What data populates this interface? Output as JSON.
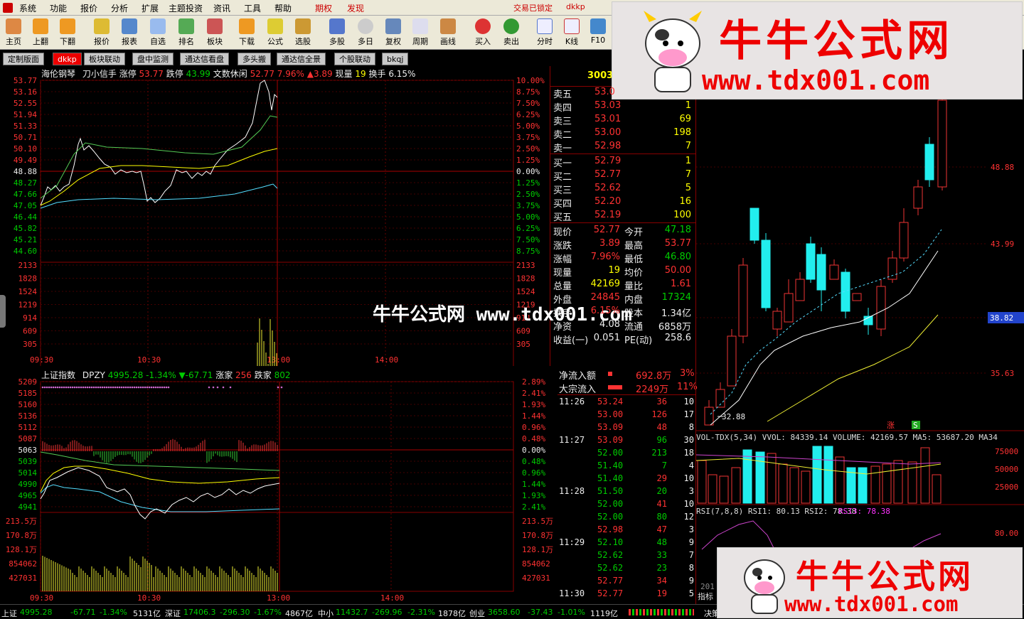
{
  "menu": {
    "items": [
      "系统",
      "功能",
      "报价",
      "分析",
      "扩展",
      "主题投资",
      "资讯",
      "工具",
      "帮助"
    ],
    "tabs_red": [
      "期权",
      "发现"
    ],
    "trade_status": "交易已锁定",
    "user": "dkkp"
  },
  "toolbar": [
    "主页",
    "上翻",
    "下翻",
    "报价",
    "报表",
    "自选",
    "排名",
    "板块",
    "下载",
    "公式",
    "选股",
    "多股",
    "多日",
    "复权",
    "周期",
    "画线",
    "买入",
    "卖出",
    "分时",
    "K线",
    "F10"
  ],
  "tabs": [
    "定制版面",
    "dkkp",
    "板块联动",
    "盘中监测",
    "通达信看盘",
    "多头搬",
    "通达信全景",
    "个股联动",
    "bkqj"
  ],
  "stock": {
    "name": "海伦钢琴",
    "indicator": "刀小信手",
    "limit_up_label": "涨停",
    "limit_up": "53.77",
    "limit_down_label": "跌停",
    "limit_down": "43.99",
    "note": "文数休闲",
    "price": "52.77",
    "pct": "7.96%",
    "change": "▲3.89",
    "vol_label": "现量",
    "vol": "19",
    "turnover_label": "换手",
    "turnover": "6.15%",
    "code": "30032"
  },
  "price_axis": [
    "53.77",
    "53.16",
    "52.55",
    "51.94",
    "51.33",
    "50.71",
    "50.10",
    "49.49",
    "48.88",
    "48.27",
    "47.66",
    "47.05",
    "46.44",
    "45.82",
    "45.21",
    "44.60"
  ],
  "pct_axis": [
    "10.00%",
    "8.75%",
    "7.50%",
    "6.25%",
    "5.00%",
    "3.75%",
    "2.50%",
    "1.25%",
    "0.00%",
    "1.25%",
    "2.50%",
    "3.75%",
    "5.00%",
    "6.25%",
    "7.50%",
    "8.75%"
  ],
  "vol_axis": [
    "2133",
    "1828",
    "1524",
    "1219",
    "914",
    "609",
    "305"
  ],
  "time_axis": [
    "09:30",
    "10:30",
    "13:00",
    "14:00"
  ],
  "index": {
    "name": "上证指数",
    "code": "DPZY",
    "value": "4995.28",
    "pct": "-1.34%",
    "change": "▼-67.71",
    "up_label": "涨家",
    "up": "256",
    "down_label": "跌家",
    "down": "802"
  },
  "index_axis": [
    "5209",
    "5185",
    "5160",
    "5136",
    "5112",
    "5087",
    "5063",
    "5039",
    "5014",
    "4990",
    "4965",
    "4941"
  ],
  "index_pct_axis": [
    "2.89%",
    "2.41%",
    "1.93%",
    "1.44%",
    "0.96%",
    "0.48%",
    "0.00%",
    "0.48%",
    "0.96%",
    "1.44%",
    "1.93%",
    "2.41%"
  ],
  "index_vol_axis": [
    "213.5万",
    "170.8万",
    "128.1万",
    "854062",
    "427031"
  ],
  "asks": [
    {
      "label": "卖五",
      "price": "53.0",
      "vol": ""
    },
    {
      "label": "卖四",
      "price": "53.03",
      "vol": "1"
    },
    {
      "label": "卖三",
      "price": "53.01",
      "vol": "69"
    },
    {
      "label": "卖二",
      "price": "53.00",
      "vol": "198"
    },
    {
      "label": "卖一",
      "price": "52.98",
      "vol": "7"
    }
  ],
  "bids": [
    {
      "label": "买一",
      "price": "52.79",
      "vol": "1"
    },
    {
      "label": "买二",
      "price": "52.77",
      "vol": "7"
    },
    {
      "label": "买三",
      "price": "52.62",
      "vol": "5"
    },
    {
      "label": "买四",
      "price": "52.20",
      "vol": "16"
    },
    {
      "label": "买五",
      "price": "52.19",
      "vol": "100"
    }
  ],
  "stats": [
    {
      "l1": "现价",
      "v1": "52.77",
      "l2": "今开",
      "v2": "47.18"
    },
    {
      "l1": "涨跌",
      "v1": "3.89",
      "l2": "最高",
      "v2": "53.77"
    },
    {
      "l1": "涨幅",
      "v1": "7.96%",
      "l2": "最低",
      "v2": "46.80"
    },
    {
      "l1": "现量",
      "v1": "19",
      "l2": "均价",
      "v2": "50.00"
    },
    {
      "l1": "总量",
      "v1": "42169",
      "l2": "量比",
      "v2": "1.61"
    },
    {
      "l1": "外盘",
      "v1": "24845",
      "l2": "内盘",
      "v2": "17324"
    },
    {
      "l1": "换手",
      "v1": "6.15%",
      "l2": "股本",
      "v2": "1.34亿"
    },
    {
      "l1": "净资",
      "v1": "4.08",
      "l2": "流通",
      "v2": "6858万"
    },
    {
      "l1": "收益(一)",
      "v1": "0.051",
      "l2": "PE(动)",
      "v2": "258.6"
    }
  ],
  "flow": [
    {
      "label": "净流入额",
      "value": "692.8万",
      "pct": "3%"
    },
    {
      "label": "大宗流入",
      "value": "2249万",
      "pct": "11%"
    }
  ],
  "ticks": [
    {
      "t": "11:26",
      "p": "53.24",
      "v": "36",
      "n": "10"
    },
    {
      "t": "",
      "p": "53.00",
      "v": "126",
      "n": "17"
    },
    {
      "t": "",
      "p": "53.09",
      "v": "48",
      "n": "8"
    },
    {
      "t": "11:27",
      "p": "53.09",
      "v": "96",
      "n": "30"
    },
    {
      "t": "",
      "p": "52.00",
      "v": "213",
      "n": "18"
    },
    {
      "t": "",
      "p": "51.40",
      "v": "7",
      "n": "4"
    },
    {
      "t": "",
      "p": "51.40",
      "v": "29",
      "n": "10"
    },
    {
      "t": "11:28",
      "p": "51.50",
      "v": "20",
      "n": "3"
    },
    {
      "t": "",
      "p": "52.00",
      "v": "41",
      "n": "10"
    },
    {
      "t": "",
      "p": "52.00",
      "v": "80",
      "n": "12"
    },
    {
      "t": "",
      "p": "52.98",
      "v": "47",
      "n": "3"
    },
    {
      "t": "11:29",
      "p": "52.10",
      "v": "48",
      "n": "9"
    },
    {
      "t": "",
      "p": "52.62",
      "v": "33",
      "n": "7"
    },
    {
      "t": "",
      "p": "52.62",
      "v": "23",
      "n": "8"
    },
    {
      "t": "",
      "p": "52.77",
      "v": "34",
      "n": "9"
    },
    {
      "t": "11:30",
      "p": "52.77",
      "v": "19",
      "n": "5"
    }
  ],
  "kline": {
    "axis": [
      "48.88",
      "43.99",
      "38.82",
      "35.63"
    ],
    "current": "38.82",
    "low_mark": "32.88",
    "vol_title": "VOL-TDX(5,34) VVOL: 84339.14  VOLUME: 42169.57  MA5: 53687.20  MA34",
    "vol_axis": [
      "75000",
      "50000",
      "25000"
    ],
    "rsi_title": "RSI(7,8,8)  RSI1: 80.13  RSI2: 78.38",
    "rsi3": "RSI3: 78.38",
    "rsi_axis": "80.00",
    "tag_up": "涨",
    "tag_s": "S",
    "bottom_label": "指标",
    "bottom_year": "201"
  },
  "watermark": {
    "brand": "牛牛公式网",
    "url": "www.tdx001.com",
    "overlay": "牛牛公式网 www.tdx001.com"
  },
  "statusbar": {
    "sh_label": "上证",
    "sh": "4995.28",
    "sh_chg": "-67.71",
    "sh_pct": "-1.34%",
    "sh_amt": "5131亿",
    "sz_label": "深证",
    "sz": "17406.3",
    "sz_chg": "-296.30",
    "sz_pct": "-1.67%",
    "sz_amt": "4867亿",
    "zx_label": "中小",
    "zx": "11432.7",
    "zx_chg": "-269.96",
    "zx_pct": "-2.31%",
    "zx_amt": "1878亿",
    "cy_label": "创业",
    "cy": "3658.60",
    "cy_chg": "-37.43",
    "cy_pct": "-1.01%",
    "cy_amt": "1119亿",
    "end": "决策"
  }
}
